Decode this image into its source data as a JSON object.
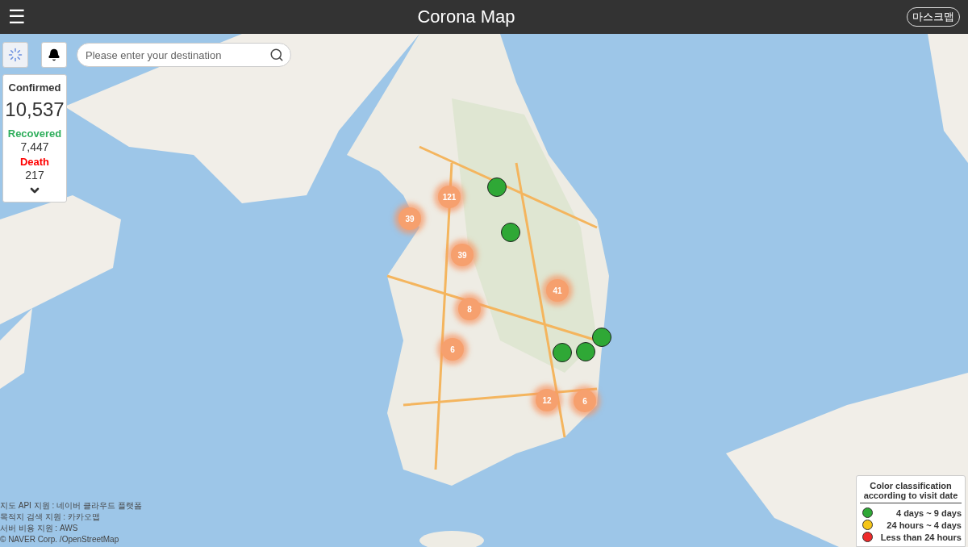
{
  "header": {
    "menu": "☰",
    "title": "Corona Map",
    "mask_map_button": "마스크맵"
  },
  "search": {
    "placeholder": "Please enter your destination"
  },
  "stats": {
    "confirmed_label": "Confirmed",
    "confirmed": "10,537",
    "recovered_label": "Recovered",
    "recovered": "7,447",
    "death_label": "Death",
    "death": "217"
  },
  "clusters": [
    {
      "count": "121"
    },
    {
      "count": "39"
    },
    {
      "count": "39"
    },
    {
      "count": "41"
    },
    {
      "count": "8"
    },
    {
      "count": "6"
    },
    {
      "count": "12"
    },
    {
      "count": "6"
    }
  ],
  "visit_markers": [
    {
      "color": "#2fa836"
    },
    {
      "color": "#2fa836"
    },
    {
      "color": "#2fa836"
    },
    {
      "color": "#2fa836"
    },
    {
      "color": "#2fa836"
    }
  ],
  "legend": {
    "title": "Color classification according to visit date",
    "items": [
      {
        "label": "4 days ~ 9 days",
        "color": "#2fa836"
      },
      {
        "label": "24 hours ~ 4 days",
        "color": "#f5c518"
      },
      {
        "label": "Less than 24 hours",
        "color": "#ee2a2a"
      }
    ]
  },
  "attribution": [
    "지도 API 지원 : 네이버 클라우드 플랫폼",
    "목적지 검색 지원 : 카카오맵",
    "서버 비용 지원 : AWS",
    "© NAVER Corp. /OpenStreetMap"
  ]
}
